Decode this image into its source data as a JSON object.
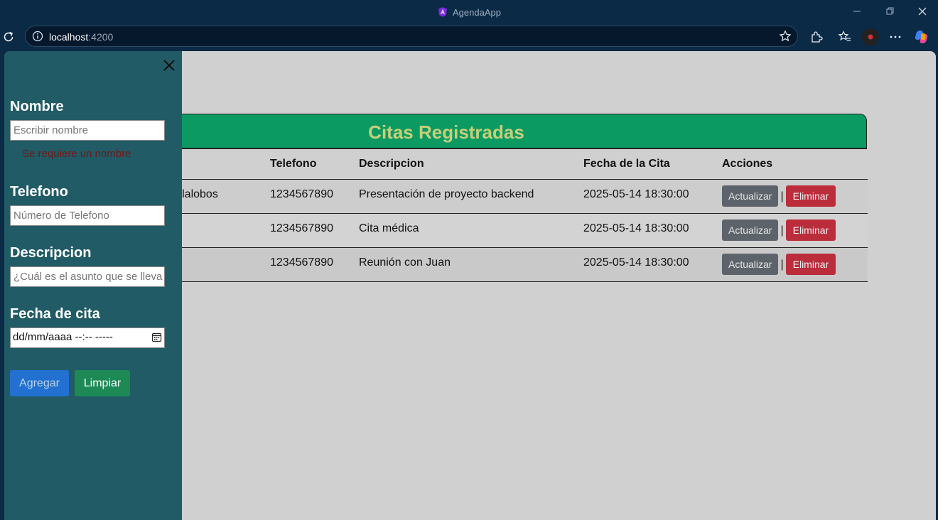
{
  "window": {
    "title": "AgendaApp"
  },
  "browser": {
    "url_host": "localhost",
    "url_port": ":4200"
  },
  "table": {
    "title": "Citas Registradas",
    "headers": [
      "Telefono",
      "Descripcion",
      "Fecha de la Cita",
      "Acciones"
    ],
    "rows": [
      {
        "name_fragment": "illalobos",
        "telefono": "1234567890",
        "descripcion": "Presentación de proyecto backend",
        "fecha": "2025-05-14 18:30:00"
      },
      {
        "name_fragment": "",
        "telefono": "1234567890",
        "descripcion": "Cita médica",
        "fecha": "2025-05-14 18:30:00"
      },
      {
        "name_fragment": "",
        "telefono": "1234567890",
        "descripcion": "Reunión con Juan",
        "fecha": "2025-05-14 18:30:00"
      }
    ],
    "update_label": "Actualizar",
    "separator": "|",
    "delete_label": "Eliminar"
  },
  "form": {
    "nombre_label": "Nombre",
    "nombre_placeholder": "Escribir nombre",
    "nombre_error": "Se requiere un nombre",
    "telefono_label": "Telefono",
    "telefono_placeholder": "Número de Telefono",
    "descripcion_label": "Descripcion",
    "descripcion_placeholder": "¿Cuál es el asunto que se lleva",
    "fecha_label": "Fecha de cita",
    "fecha_value": "dd/mm/aaaa --:--  -----",
    "add_label": "Agregar",
    "clear_label": "Limpiar"
  },
  "colors": {
    "header_green": "#0a9a62",
    "sidebar": "#215b66",
    "add_blue": "#2270d0",
    "clear_green": "#1d8a55",
    "delete_red": "#bb2d3b",
    "update_gray": "#5c636a"
  }
}
